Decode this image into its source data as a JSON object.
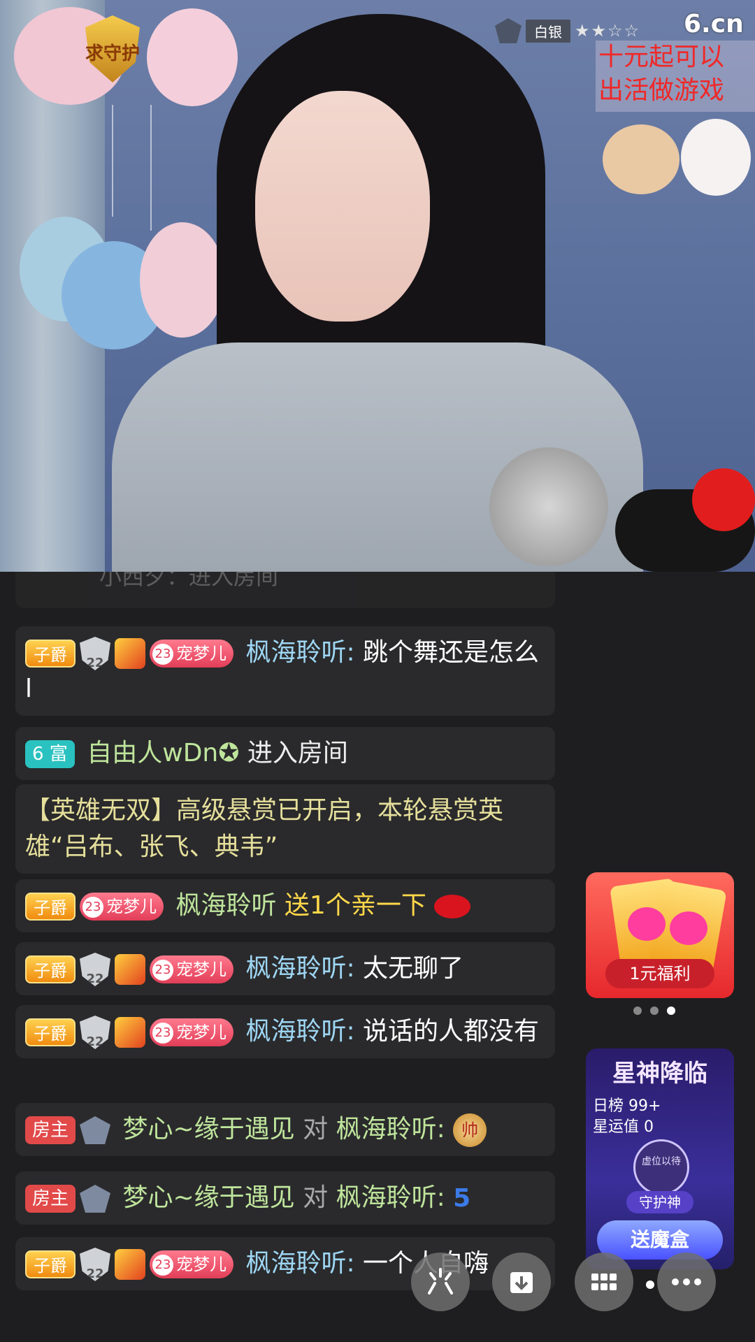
{
  "video": {
    "guard_badge": "求守护",
    "rank_label": "白银",
    "rank_stars": "★★☆☆",
    "site_logo": "6.cn",
    "promo_line1": "十元起可以",
    "promo_line2": "出活做游戏"
  },
  "chat": {
    "ghost_text": "小西夕：进入房间",
    "messages": [
      {
        "badge": "子爵",
        "level": "22",
        "pet_level": "23",
        "pet_name": "宠梦儿",
        "user": "枫海聆听:",
        "text": "跳个舞还是怎么l"
      },
      {
        "badge": "6 富",
        "user": "自由人wDn✪",
        "text": "进入房间"
      },
      {
        "text": "【英雄无双】高级悬赏已开启，本轮悬赏英雄“吕布、张飞、典韦”"
      },
      {
        "badge": "子爵",
        "pet_level": "23",
        "pet_name": "宠梦儿",
        "user": "枫海聆听",
        "text": "送1个亲一下"
      },
      {
        "badge": "子爵",
        "level": "22",
        "pet_level": "23",
        "pet_name": "宠梦儿",
        "user": "枫海聆听:",
        "text": "太无聊了"
      },
      {
        "badge": "子爵",
        "level": "22",
        "pet_level": "23",
        "pet_name": "宠梦儿",
        "user": "枫海聆听:",
        "text": "说话的人都没有"
      },
      {
        "badge": "房主",
        "user": "梦心~缘于遇见",
        "mid": "对",
        "target": "枫海聆听:",
        "icon_text": "帅"
      },
      {
        "badge": "房主",
        "user": "梦心~缘于遇见",
        "mid": "对",
        "target": "枫海聆听:",
        "icon_text": "5"
      },
      {
        "badge": "子爵",
        "level": "22",
        "pet_level": "23",
        "pet_name": "宠梦儿",
        "user": "枫海聆听:",
        "text": "一个人自嗨"
      }
    ],
    "guard_char": "守"
  },
  "widgets": {
    "welfare_label": "1元福利",
    "star_title": "星神降临",
    "day_rank": "日榜 99+",
    "star_luck": "星运值 0",
    "seat_wait": "虚位以待",
    "guardian_tag": "守护神",
    "magic_button": "送魔盒"
  },
  "colors": {
    "username": "#9ed6f3",
    "system": "#e5df9b",
    "gift": "#ffd84a",
    "green_name": "#bfe59c"
  }
}
